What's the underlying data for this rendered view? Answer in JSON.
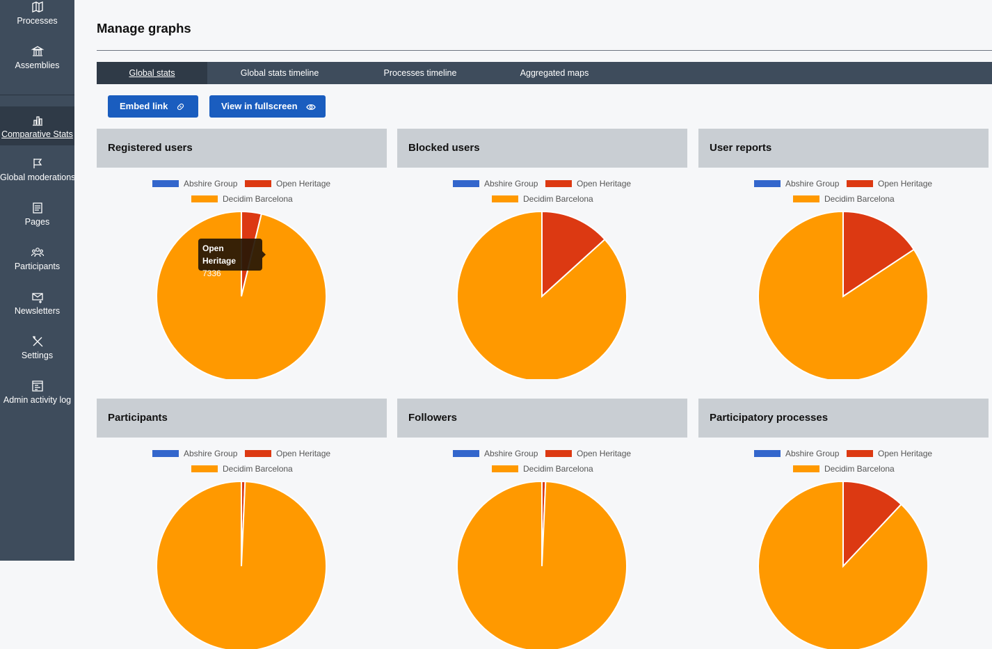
{
  "sidebar": {
    "items": [
      {
        "label": "Processes",
        "icon": "map-icon"
      },
      {
        "label": "Assemblies",
        "icon": "institution-icon"
      },
      {
        "label": "Comparative Stats",
        "icon": "bar-chart-icon",
        "active": true
      },
      {
        "label": "Global moderations",
        "icon": "flag-icon"
      },
      {
        "label": "Pages",
        "icon": "page-icon"
      },
      {
        "label": "Participants",
        "icon": "users-icon"
      },
      {
        "label": "Newsletters",
        "icon": "mail-icon"
      },
      {
        "label": "Settings",
        "icon": "tools-icon"
      },
      {
        "label": "Admin activity log",
        "icon": "log-icon"
      }
    ]
  },
  "page": {
    "title": "Manage graphs"
  },
  "tabs": [
    {
      "label": "Global stats",
      "active": true
    },
    {
      "label": "Global stats timeline"
    },
    {
      "label": "Processes timeline"
    },
    {
      "label": "Aggregated maps"
    }
  ],
  "actions": {
    "embed_label": "Embed link",
    "fullscreen_label": "View in fullscreen"
  },
  "colors": {
    "abshire": "#3366cc",
    "heritage": "#dc3912",
    "barcelona": "#ff9900"
  },
  "legend": {
    "abshire": "Abshire Group",
    "heritage": "Open Heritage",
    "barcelona": "Decidim Barcelona"
  },
  "tooltip": {
    "title": "Open Heritage",
    "value": "7336"
  },
  "panels": [
    {
      "title": "Registered users"
    },
    {
      "title": "Blocked users"
    },
    {
      "title": "User reports"
    },
    {
      "title": "Participants"
    },
    {
      "title": "Followers"
    },
    {
      "title": "Participatory processes"
    }
  ],
  "chart_data": [
    {
      "type": "pie",
      "title": "Registered users",
      "categories": [
        "Abshire Group",
        "Open Heritage",
        "Decidim Barcelona"
      ],
      "values": [
        0,
        3.8,
        96.2
      ]
    },
    {
      "type": "pie",
      "title": "Blocked users",
      "categories": [
        "Abshire Group",
        "Open Heritage",
        "Decidim Barcelona"
      ],
      "values": [
        0,
        13.3,
        86.7
      ]
    },
    {
      "type": "pie",
      "title": "User reports",
      "categories": [
        "Abshire Group",
        "Open Heritage",
        "Decidim Barcelona"
      ],
      "values": [
        0,
        15.7,
        84.3
      ]
    },
    {
      "type": "pie",
      "title": "Participants",
      "categories": [
        "Abshire Group",
        "Open Heritage",
        "Decidim Barcelona"
      ],
      "values": [
        0,
        0.7,
        99.3
      ]
    },
    {
      "type": "pie",
      "title": "Followers",
      "categories": [
        "Abshire Group",
        "Open Heritage",
        "Decidim Barcelona"
      ],
      "values": [
        0,
        0.7,
        99.3
      ]
    },
    {
      "type": "pie",
      "title": "Participatory processes",
      "categories": [
        "Abshire Group",
        "Open Heritage",
        "Decidim Barcelona"
      ],
      "values": [
        0,
        12.0,
        88.0
      ]
    }
  ]
}
